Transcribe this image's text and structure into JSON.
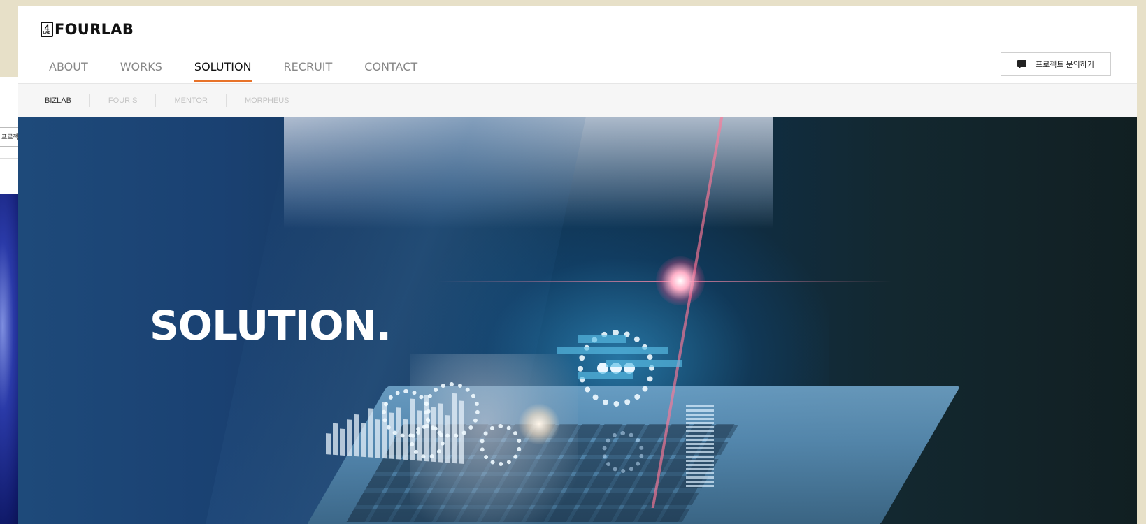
{
  "background_window": {
    "button_label": "프로젝"
  },
  "header": {
    "logo_mark": "4",
    "logo_mark_sub": "LAB",
    "logo_text": "FOURLAB",
    "nav": [
      {
        "label": "ABOUT",
        "active": false
      },
      {
        "label": "WORKS",
        "active": false
      },
      {
        "label": "SOLUTION",
        "active": true
      },
      {
        "label": "RECRUIT",
        "active": false
      },
      {
        "label": "CONTACT",
        "active": false
      }
    ],
    "inquiry_button": {
      "label": "프로젝트 문의하기",
      "icon": "chat-icon"
    }
  },
  "subnav": [
    {
      "label": "BIZLAB",
      "active": true
    },
    {
      "label": "FOUR S",
      "active": false
    },
    {
      "label": "MENTOR",
      "active": false
    },
    {
      "label": "MORPHEUS",
      "active": false
    }
  ],
  "hero": {
    "title": "SOLUTION."
  },
  "colors": {
    "accent": "#e8732a",
    "page_bg": "#e7e0c8"
  }
}
